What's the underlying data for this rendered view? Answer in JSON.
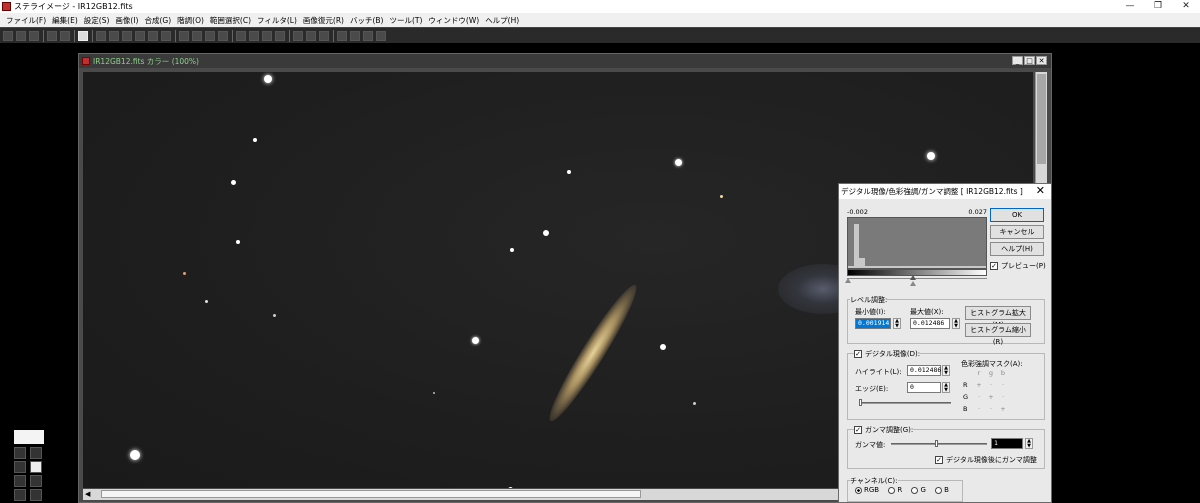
{
  "app": {
    "title": "ステライメージ - IR12GB12.fits",
    "controls": [
      "—",
      "❐",
      "✕"
    ]
  },
  "menu": [
    "ファイル(F)",
    "編集(E)",
    "設定(S)",
    "画像(I)",
    "合成(G)",
    "階調(O)",
    "範囲選択(C)",
    "フィルタ(L)",
    "画像復元(R)",
    "バッチ(B)",
    "ツール(T)",
    "ウィンドウ(W)",
    "ヘルプ(H)"
  ],
  "image_window": {
    "title": "IR12GB12.fits カラー (100%)",
    "buttons": [
      "_",
      "□",
      "✕"
    ]
  },
  "dialog": {
    "title": "デジタル現像/色彩強調/ガンマ調整 [ IR12GB12.fits ]",
    "histogram": {
      "min_label": "-0.002",
      "max_label": "0.027"
    },
    "buttons": {
      "ok": "OK",
      "cancel": "キャンセル",
      "help": "ヘルプ(H)"
    },
    "preview_label": "プレビュー(P)",
    "level": {
      "group_label": "レベル調整:",
      "min_label": "最小値(I):",
      "max_label": "最大値(X):",
      "min_value": "0.001914",
      "max_value": "0.012486",
      "expand_button": "ヒストグラム拡大(M)",
      "shrink_button": "ヒストグラム縮小(R)"
    },
    "digital": {
      "group_label": "デジタル現像(D):",
      "highlight_label": "ハイライト(L):",
      "highlight_value": "0.012486",
      "edge_label": "エッジ(E):",
      "edge_value": "0",
      "mask_label": "色彩強調マスク(A):",
      "mask_cols": [
        "r",
        "g",
        "b"
      ],
      "mask_rows": [
        "R",
        "G",
        "B"
      ]
    },
    "gamma": {
      "group_label": "ガンマ調整(G):",
      "value_label": "ガンマ値:",
      "value": "1",
      "after_label": "デジタル現像後にガンマ調整"
    },
    "channel": {
      "group_label": "チャンネル(C):",
      "options": [
        "RGB",
        "R",
        "G",
        "B"
      ],
      "selected": "RGB"
    }
  }
}
